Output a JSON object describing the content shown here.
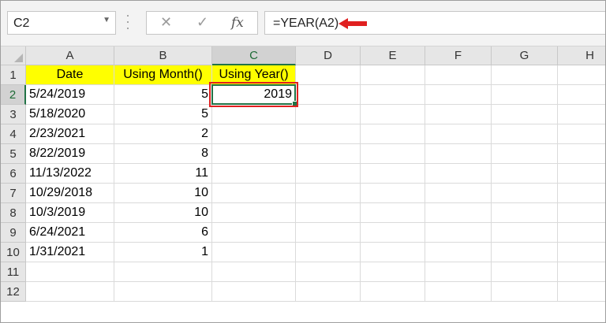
{
  "name_box": {
    "value": "C2"
  },
  "formula_bar": {
    "cancel_icon": "cancel-x-icon",
    "enter_icon": "checkmark-icon",
    "fx_label": "fx",
    "formula": "=YEAR(A2)",
    "arrow_color": "#e02020"
  },
  "columns": [
    "A",
    "B",
    "C",
    "D",
    "E",
    "F",
    "G",
    "H"
  ],
  "rows": [
    "1",
    "2",
    "3",
    "4",
    "5",
    "6",
    "7",
    "8",
    "9",
    "10",
    "11",
    "12"
  ],
  "headers": {
    "a": "Date",
    "b": "Using Month()",
    "c": "Using Year()"
  },
  "data": [
    {
      "date": "5/24/2019",
      "month": "5",
      "year": "2019"
    },
    {
      "date": "5/18/2020",
      "month": "5",
      "year": ""
    },
    {
      "date": "2/23/2021",
      "month": "2",
      "year": ""
    },
    {
      "date": "8/22/2019",
      "month": "8",
      "year": ""
    },
    {
      "date": "11/13/2022",
      "month": "11",
      "year": ""
    },
    {
      "date": "10/29/2018",
      "month": "10",
      "year": ""
    },
    {
      "date": "10/3/2019",
      "month": "10",
      "year": ""
    },
    {
      "date": "6/24/2021",
      "month": "6",
      "year": ""
    },
    {
      "date": "1/31/2021",
      "month": "1",
      "year": ""
    }
  ],
  "colors": {
    "header_fill": "#ffff00",
    "selection": "#217346",
    "highlight": "#e02020"
  }
}
